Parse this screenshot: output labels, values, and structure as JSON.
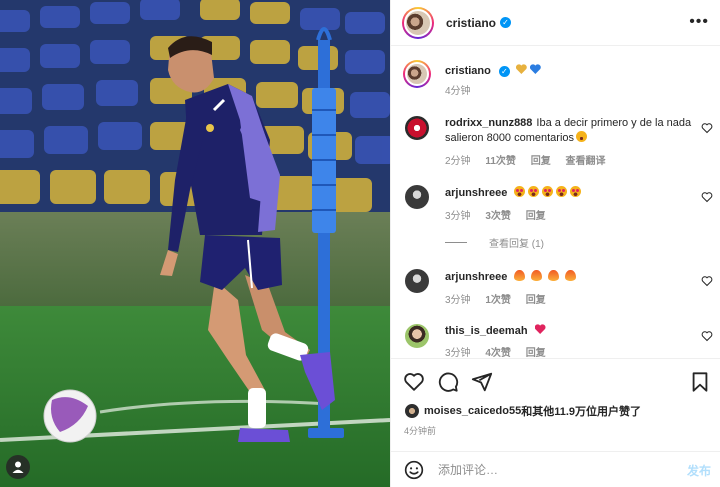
{
  "post": {
    "owner": "cristiano",
    "verified": true,
    "caption_emojis": [
      "yellow-heart",
      "blue-heart"
    ],
    "caption_time": "4分钟",
    "more_icon": "more-horizontal-icon"
  },
  "comments": [
    {
      "user": "rodrixx_nunz888",
      "text": "Iba a decir primero y de la nada salieron 8000 comentarios",
      "emoji": "astonished-face",
      "time": "2分钟",
      "likes": "11次赞",
      "reply": "回复",
      "translate": "查看翻译"
    },
    {
      "user": "arjunshreee",
      "emojis": [
        "heart-eyes",
        "heart-eyes",
        "heart-eyes",
        "heart-eyes",
        "heart-eyes"
      ],
      "time": "3分钟",
      "likes": "3次赞",
      "reply": "回复"
    },
    {
      "view_replies": "查看回复 (1)"
    },
    {
      "user": "arjunshreee",
      "emojis": [
        "fire",
        "fire",
        "fire",
        "fire"
      ],
      "time": "3分钟",
      "likes": "1次赞",
      "reply": "回复"
    },
    {
      "user": "this_is_deemah",
      "emojis": [
        "pink-heart"
      ],
      "time": "3分钟",
      "likes": "4次赞",
      "reply": "回复"
    }
  ],
  "actions": {
    "liked_by_user": "moises_caicedo55",
    "liked_by_rest": "和其他11.9万位用户赞了",
    "time_ago": "4分钟前",
    "comment_placeholder": "添加评论…",
    "post_label": "发布"
  },
  "colors": {
    "accent": "#0095f6",
    "post_disabled": "#b2dffc",
    "muted": "#8e8e8e"
  }
}
